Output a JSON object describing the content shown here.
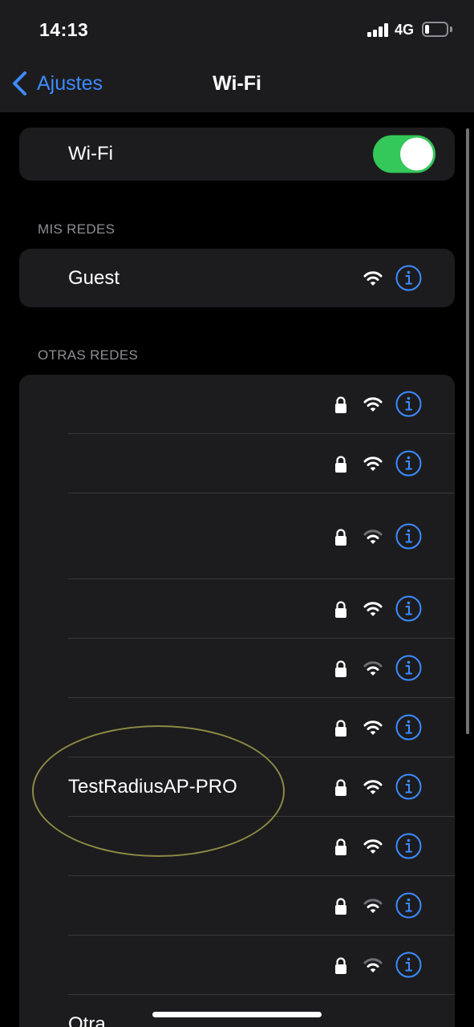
{
  "status_bar": {
    "time": "14:13",
    "network": "4G"
  },
  "nav": {
    "back_label": "Ajustes",
    "title": "Wi-Fi"
  },
  "wifi_toggle": {
    "label": "Wi-Fi",
    "on": true
  },
  "my_networks": {
    "header": "MIS REDES",
    "items": [
      {
        "name": "Guest",
        "locked": false,
        "signal": "full"
      }
    ]
  },
  "other_networks": {
    "header": "OTRAS REDES",
    "items": [
      {
        "name": "",
        "locked": true,
        "signal": "full"
      },
      {
        "name": "",
        "locked": true,
        "signal": "full"
      },
      {
        "name": "",
        "locked": true,
        "signal": "weak"
      },
      {
        "name": "",
        "locked": true,
        "signal": "full"
      },
      {
        "name": "",
        "locked": true,
        "signal": "weak"
      },
      {
        "name": "",
        "locked": true,
        "signal": "full"
      },
      {
        "name": "TestRadiusAP-PRO",
        "locked": true,
        "signal": "full"
      },
      {
        "name": "",
        "locked": true,
        "signal": "full"
      },
      {
        "name": "",
        "locked": true,
        "signal": "weak"
      },
      {
        "name": "",
        "locked": true,
        "signal": "weak"
      }
    ],
    "other_label": "Otra..."
  },
  "colors": {
    "accent": "#3d8bff",
    "toggle_on": "#34c759",
    "cell_bg": "#1c1c1e",
    "highlight": "#8d8a45"
  },
  "icons": {
    "lock": "lock-icon",
    "wifi": "wifi-icon",
    "info": "info-icon",
    "back": "chevron-left-icon"
  }
}
